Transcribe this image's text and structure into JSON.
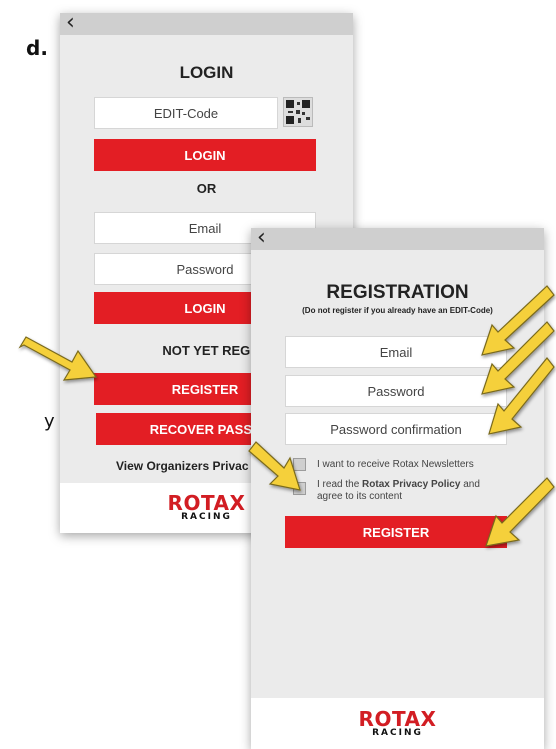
{
  "left_cut": {
    "top_char": "d.",
    "bottom_char": "y"
  },
  "login_screen": {
    "title": "LOGIN",
    "edit_code_placeholder": "EDIT-Code",
    "login_button": "LOGIN",
    "or_label": "OR",
    "email_placeholder": "Email",
    "password_placeholder": "Password",
    "login_button_2": "LOGIN",
    "not_registered": "NOT YET REGISTER",
    "register_button": "REGISTER",
    "recover_button": "RECOVER PASSW",
    "privacy_link": "View Organizers Privac",
    "logo_main": "ROTAX",
    "logo_sub": "RACING"
  },
  "registration_screen": {
    "title": "REGISTRATION",
    "subtitle": "(Do not register if you already have an EDIT-Code)",
    "email_placeholder": "Email",
    "password_placeholder": "Password",
    "password_confirm_placeholder": "Password confirmation",
    "newsletter_label": "I want to receive Rotax Newsletters",
    "privacy_prefix": "I read the ",
    "privacy_bold": "Rotax Privacy Policy",
    "privacy_suffix": " and",
    "privacy_line2": "agree to its content",
    "register_button": "REGISTER",
    "logo_main": "ROTAX",
    "logo_sub": "RACING"
  },
  "colors": {
    "accent_red": "#e31e24",
    "arrow_yellow": "#f5d03a"
  },
  "icons": {
    "back": "chevron-left-icon",
    "qr": "qr-code-icon",
    "arrow": "pointer-arrow-icon"
  }
}
